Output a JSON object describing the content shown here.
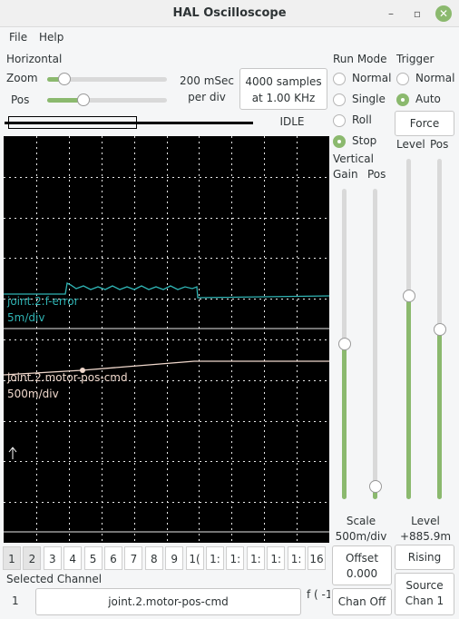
{
  "window": {
    "title": "HAL Oscilloscope",
    "minimize_glyph": "–",
    "maximize_glyph": "▫",
    "close_glyph": "✕"
  },
  "menu": {
    "file": "File",
    "help": "Help"
  },
  "horizontal": {
    "title": "Horizontal",
    "zoom_label": "Zoom",
    "pos_label": "Pos",
    "zoom_level": 0.1,
    "pos_level": 0.28,
    "rate_line1": "200 mSec",
    "rate_line2": "per div",
    "samples_line1": "4000 samples",
    "samples_line2": "at 1.00 KHz",
    "status": "IDLE"
  },
  "run_mode": {
    "title": "Run Mode",
    "options": [
      "Normal",
      "Single",
      "Roll",
      "Stop"
    ],
    "selected": "Stop"
  },
  "trigger": {
    "title": "Trigger",
    "options": [
      "Normal",
      "Auto"
    ],
    "selected": "Auto",
    "force_label": "Force",
    "level_label": "Level",
    "pos_label": "Pos",
    "level_value_label": "Level",
    "level_value": "+885.9m",
    "level_level": 0.6,
    "pos_level": 0.5,
    "edge_label": "Rising",
    "source_line1": "Source",
    "source_line2": "Chan  1"
  },
  "vertical": {
    "title": "Vertical",
    "gain_label": "Gain",
    "pos_label": "Pos",
    "gain_level": 0.5,
    "pos_level": 0.02,
    "scale_label": "Scale",
    "scale_value": "500m/div",
    "offset_line1": "Offset",
    "offset_line2": "0.000",
    "chan_off_label": "Chan Off"
  },
  "scope": {
    "background": "#000000",
    "grid_color": "#e8e8e8",
    "trace1": {
      "name": "joint.2.f-error",
      "scale": "5m/div",
      "color": "#2fb3b3"
    },
    "trace2": {
      "name": "joint.2.motor-pos-cmd",
      "scale": "500m/div",
      "color": "#f0d8cc"
    }
  },
  "channels": {
    "buttons": [
      "1",
      "2",
      "3",
      "4",
      "5",
      "6",
      "7",
      "8",
      "9",
      "1(",
      "1:",
      "1:",
      "1:",
      "1:",
      "1:",
      "16"
    ],
    "enabled": [
      1,
      2
    ]
  },
  "selected_channel": {
    "title": "Selected Channel",
    "number": "1",
    "name": "joint.2.motor-pos-cmd",
    "formula": "f ( -1"
  }
}
